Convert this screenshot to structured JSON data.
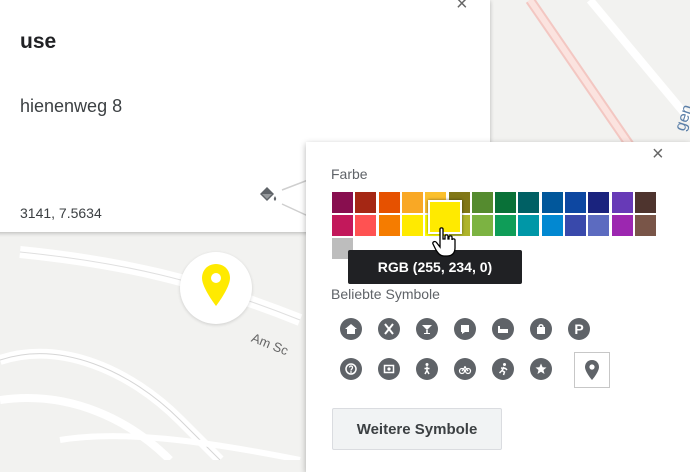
{
  "info_card": {
    "title": "use",
    "address": "hienenweg 8",
    "coords": "3141, 7.5634",
    "close_icon": "×"
  },
  "map": {
    "street_label": "Am Sc",
    "street_label_right": "gen"
  },
  "style_popup": {
    "close_icon": "×",
    "color_section_label": "Farbe",
    "colors_row1": [
      "#880e4f",
      "#a52714",
      "#e65100",
      "#f9a825",
      "#fbc02d",
      "#817717",
      "#558b2f",
      "#097138",
      "#006064",
      "#01579b",
      "#0d47a1",
      "#1a237e",
      "#673ab7",
      "#4e342e"
    ],
    "colors_row2": [
      "#c2185b",
      "#ff5252",
      "#f57c00",
      "#ffea00",
      "#ffff00",
      "#afb42b",
      "#7cb342",
      "#0f9d58",
      "#0097a7",
      "#0288d1",
      "#3949ab",
      "#5c6bc0",
      "#9c27b0",
      "#795548"
    ],
    "colors_row3": [
      "#bdbdbd"
    ],
    "selected_color": "#ffea00",
    "tooltip": "RGB (255, 234, 0)",
    "symbols_label": "Beliebte Symbole",
    "symbols_row1": [
      "home-icon",
      "restaurant-icon",
      "bar-icon",
      "camera-shop-icon",
      "bed-icon",
      "shopping-bag-icon",
      "parking-icon"
    ],
    "symbols_row2": [
      "help-icon",
      "photo-icon",
      "walking-icon",
      "bicycle-icon",
      "running-icon",
      "star-icon",
      "map-pin-icon"
    ],
    "parking_label": "P",
    "more_symbols_button": "Weitere Symbole"
  }
}
